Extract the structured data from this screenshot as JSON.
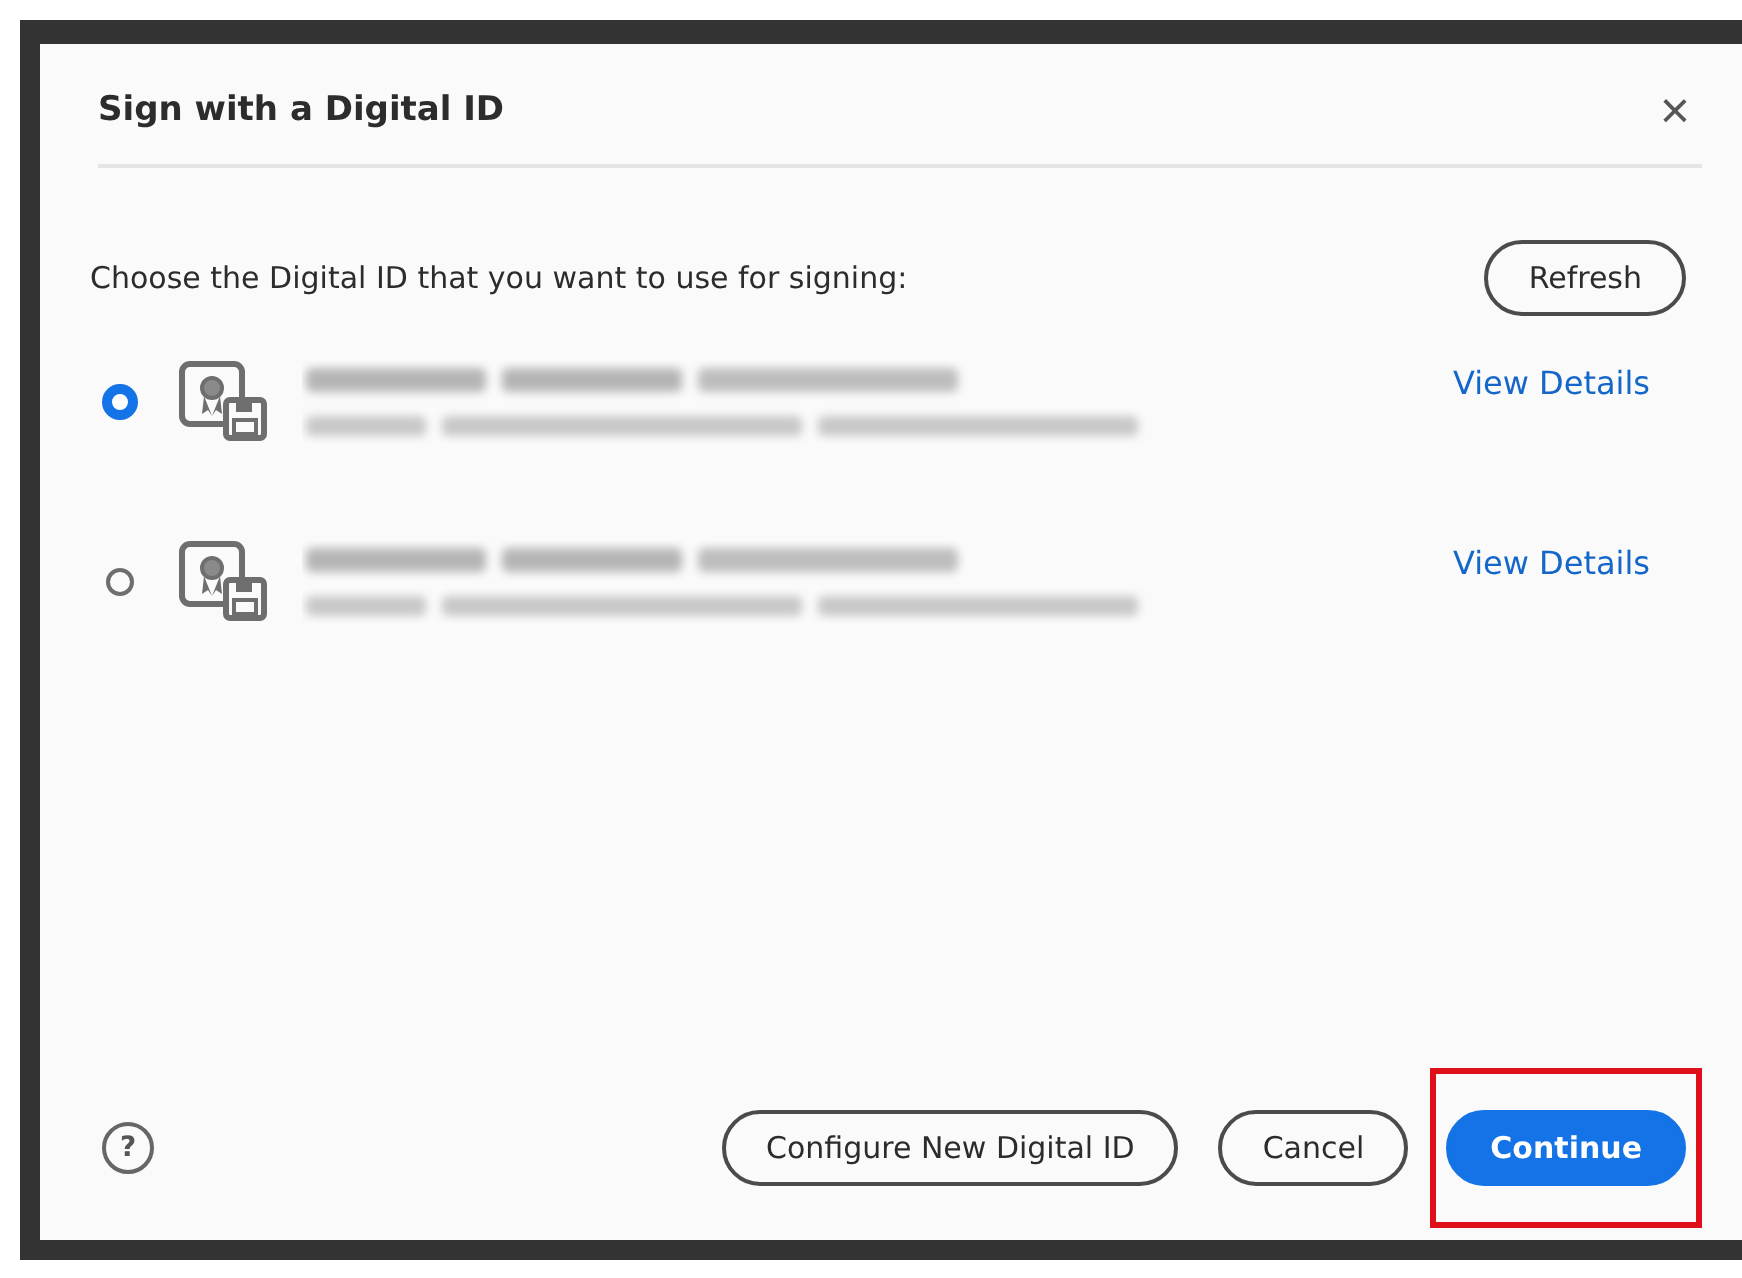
{
  "dialog": {
    "title": "Sign with a Digital ID",
    "close": "×"
  },
  "prompt": "Choose the Digital ID that you want to use for signing:",
  "refresh": "Refresh",
  "ids": [
    {
      "selected": true,
      "link": "View Details"
    },
    {
      "selected": false,
      "link": "View Details"
    }
  ],
  "help": "?",
  "buttons": [
    {
      "label": "Configure New Digital ID",
      "kind": "secondary",
      "highlighted": false
    },
    {
      "label": "Cancel",
      "kind": "secondary",
      "highlighted": false
    },
    {
      "label": "Continue",
      "kind": "primary",
      "highlighted": true
    }
  ]
}
